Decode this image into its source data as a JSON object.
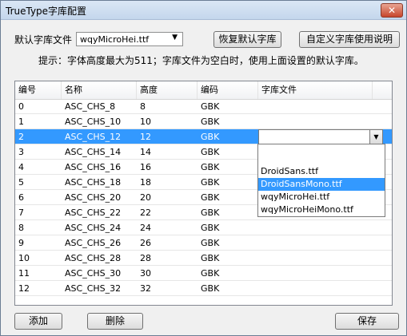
{
  "window": {
    "title": "TrueType字库配置",
    "close_glyph": "✕"
  },
  "default_font": {
    "label": "默认字库文件",
    "value": "wqyMicroHei.ttf"
  },
  "buttons": {
    "restore": "恢复默认字库",
    "custom_help": "自定义字库使用说明",
    "add": "添加",
    "delete": "删除",
    "save": "保存"
  },
  "hint": "提示：字体高度最大为511；字库文件为空白时，使用上面设置的默认字库。",
  "table": {
    "headers": [
      "编号",
      "名称",
      "高度",
      "编码",
      "字库文件"
    ],
    "rows": [
      {
        "id": "0",
        "name": "ASC_CHS_8",
        "height": "8",
        "enc": "GBK"
      },
      {
        "id": "1",
        "name": "ASC_CHS_10",
        "height": "10",
        "enc": "GBK"
      },
      {
        "id": "2",
        "name": "ASC_CHS_12",
        "height": "12",
        "enc": "GBK"
      },
      {
        "id": "3",
        "name": "ASC_CHS_14",
        "height": "14",
        "enc": "GBK"
      },
      {
        "id": "4",
        "name": "ASC_CHS_16",
        "height": "16",
        "enc": "GBK"
      },
      {
        "id": "5",
        "name": "ASC_CHS_18",
        "height": "18",
        "enc": "GBK"
      },
      {
        "id": "6",
        "name": "ASC_CHS_20",
        "height": "20",
        "enc": "GBK"
      },
      {
        "id": "7",
        "name": "ASC_CHS_22",
        "height": "22",
        "enc": "GBK"
      },
      {
        "id": "8",
        "name": "ASC_CHS_24",
        "height": "24",
        "enc": "GBK"
      },
      {
        "id": "9",
        "name": "ASC_CHS_26",
        "height": "26",
        "enc": "GBK"
      },
      {
        "id": "10",
        "name": "ASC_CHS_28",
        "height": "28",
        "enc": "GBK"
      },
      {
        "id": "11",
        "name": "ASC_CHS_30",
        "height": "30",
        "enc": "GBK"
      },
      {
        "id": "12",
        "name": "ASC_CHS_32",
        "height": "32",
        "enc": "GBK"
      }
    ],
    "selected_index": 2
  },
  "dropdown": {
    "options": [
      "DroidSans.ttf",
      "DroidSansMono.ttf",
      "wqyMicroHei.ttf",
      "wqyMicroHeiMono.ttf"
    ],
    "highlighted_index": 1
  },
  "colors": {
    "selection": "#3399ff"
  }
}
